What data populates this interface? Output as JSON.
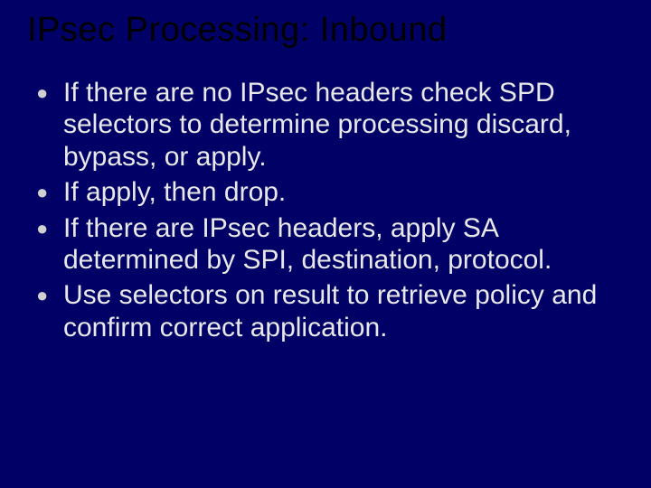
{
  "slide": {
    "title": "IPsec Processing: Inbound",
    "bullets": [
      "If there are no IPsec headers check SPD selectors to determine processing discard, bypass, or apply.",
      "If apply, then drop.",
      "If there are IPsec headers,  apply SA determined by SPI, destination, protocol.",
      "Use selectors on result to retrieve policy and confirm correct application."
    ]
  }
}
